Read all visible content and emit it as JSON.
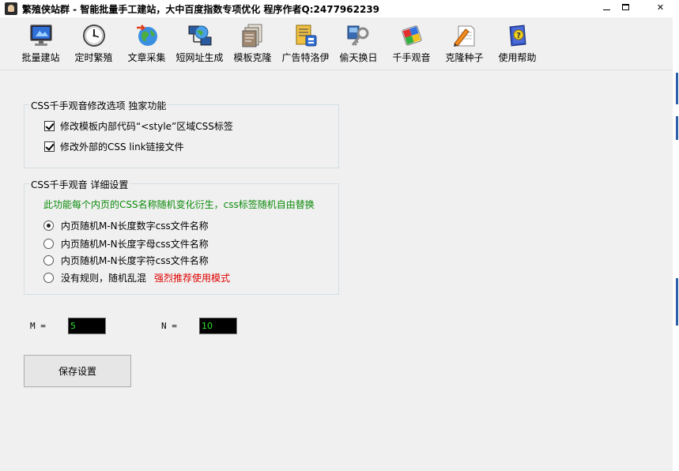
{
  "window": {
    "title": "繁殖侠站群 - 智能批量手工建站，大中百度指数专项优化 程序作者Q:2477962239",
    "close_glyph": "✕"
  },
  "toolbar": {
    "items": [
      {
        "label": "批量建站",
        "icon": "monitor-icon"
      },
      {
        "label": "定时繁殖",
        "icon": "clock-icon"
      },
      {
        "label": "文章采集",
        "icon": "globe-arrow-icon"
      },
      {
        "label": "短网址生成",
        "icon": "network-globe-icon"
      },
      {
        "label": "模板克隆",
        "icon": "document-stack-icon"
      },
      {
        "label": "广告特洛伊",
        "icon": "folder-tag-icon"
      },
      {
        "label": "偷天换日",
        "icon": "key-icon"
      },
      {
        "label": "千手观音",
        "icon": "cube-icon"
      },
      {
        "label": "克隆种子",
        "icon": "pen-paper-icon"
      },
      {
        "label": "使用帮助",
        "icon": "help-book-icon"
      }
    ]
  },
  "group1": {
    "legend": "CSS千手观音修改选项 独家功能",
    "options": [
      {
        "label": "修改模板内部代码“<style”区域CSS标签",
        "checked": true
      },
      {
        "label": "修改外部的CSS link链接文件",
        "checked": true
      }
    ]
  },
  "group2": {
    "legend": "CSS千手观音 详细设置",
    "note": "此功能每个内页的CSS名称随机变化衍生，css标签随机自由替换",
    "options": [
      {
        "label": "内页随机M-N长度数字css文件名称",
        "selected": true
      },
      {
        "label": "内页随机M-N长度字母css文件名称",
        "selected": false
      },
      {
        "label": "内页随机M-N长度字符css文件名称",
        "selected": false
      },
      {
        "label": "没有规则，随机乱混",
        "selected": false,
        "extra": "强烈推荐使用模式"
      }
    ]
  },
  "params": {
    "m_label": "M =",
    "m_value": "5",
    "n_label": "N =",
    "n_value": "10"
  },
  "actions": {
    "save_label": "保存设置"
  }
}
